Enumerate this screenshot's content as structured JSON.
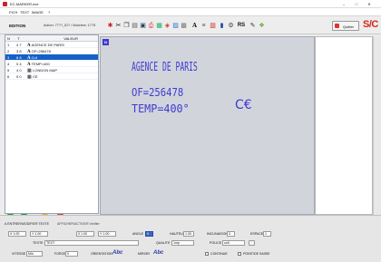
{
  "app": {
    "title": "EC-MARKER.exe"
  },
  "menu": [
    "FICH",
    "TEXT",
    "IMAGE",
    "?"
  ],
  "toolbar": {
    "mode": "EDITION",
    "info": "Action: 77??_ID? / Machine: 17?5",
    "quit": "Quitter",
    "brand": "S/C",
    "icons": [
      "figure-icon",
      "cut-icon",
      "copy-icon",
      "paste-icon",
      "save-icon",
      "print-icon",
      "grid-icon",
      "logo-icon",
      "image-icon",
      "text-a-icon",
      "text-a2-icon",
      "barcode-icon",
      "datamatrix-icon",
      "rs-icon",
      "settings-icon",
      "help-icon"
    ]
  },
  "tree": {
    "headers": [
      "N",
      "T",
      "VALEUR"
    ],
    "rows": [
      {
        "n": "1",
        "t": "4 7",
        "label": "AGENCE DE PARIS"
      },
      {
        "n": "2",
        "t": "3 8",
        "label": "OF=256478"
      },
      {
        "n": "3",
        "t": "8 8",
        "label": "Cuf"
      },
      {
        "n": "4",
        "t": "0 4",
        "label": "TEMP=400"
      },
      {
        "n": "5",
        "t": "4 0",
        "label": "LONDON MAP"
      },
      {
        "n": "6",
        "t": "5 0",
        "label": "CE"
      }
    ],
    "selected": 2
  },
  "canvas": {
    "corner": "N",
    "lines": [
      "AGENCE DE PARIS",
      "OF=256478",
      "TEMP=400°"
    ],
    "ce": "C€"
  },
  "scrollbar": {
    "label": "1 ◄ ►"
  },
  "bottom": {
    "tab_text": "A  ENTRER/MODIFIER TEXTE",
    "tab_image": "AFFICHER/ACTIVER  Verifier",
    "pos_x": "X  1.00",
    "pos_y": "Y  1.00",
    "field_c": "0  1.00",
    "field_d": "Y  1.00",
    "angle_label": "ANGLE",
    "angle_value": "0",
    "hauteur_label": "HAUTEUR",
    "hauteur_value": "1.00",
    "incl_label": "INCLINAISON",
    "incl_value": "0",
    "espace_label": "ESPACE",
    "espace_value": "1",
    "texte_label": "TEXTE",
    "texte_value": "TEXT",
    "qualite_label": "QUALITE",
    "qualite_value": "1mp",
    "police_label": "POLICE",
    "police_value": "cctt",
    "vitesse_label": "VITESSE",
    "vitesse_value": "Min",
    "force_label": "FORCE",
    "force_value": "0",
    "orient_label": "ORIENTATION",
    "orient_value": "Abc",
    "miroir_label": "MIROIR",
    "miroir_value": "Abc",
    "continue_label": "CONTINUE",
    "point_label": "POINT/DE SAISIE"
  }
}
